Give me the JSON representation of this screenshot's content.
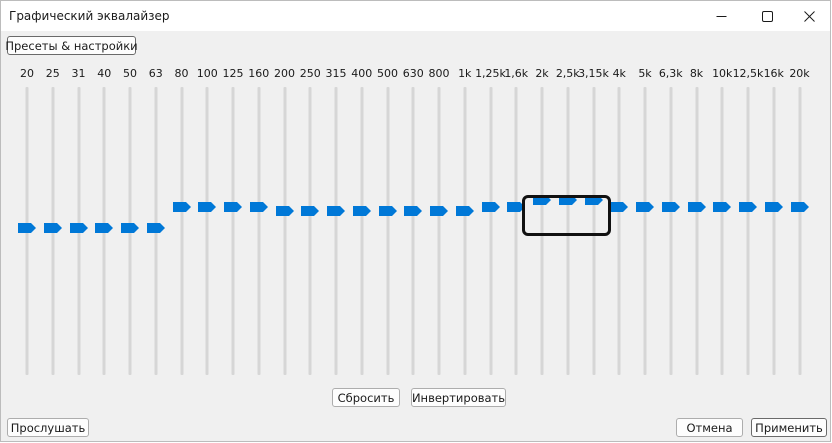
{
  "window": {
    "title": "Графический эквалайзер",
    "controls": [
      "minimize-icon",
      "maximize-icon",
      "close-icon"
    ]
  },
  "toolbar": {
    "presets_label": "Пресеты & настройки"
  },
  "equalizer": {
    "accent_color": "#0078d7",
    "bands": [
      {
        "label": "20",
        "level": 0
      },
      {
        "label": "25",
        "level": 0
      },
      {
        "label": "31",
        "level": 0
      },
      {
        "label": "40",
        "level": 0
      },
      {
        "label": "50",
        "level": 0
      },
      {
        "label": "63",
        "level": 0
      },
      {
        "label": "80",
        "level": 0.143
      },
      {
        "label": "100",
        "level": 0.143
      },
      {
        "label": "125",
        "level": 0.143
      },
      {
        "label": "160",
        "level": 0.143
      },
      {
        "label": "200",
        "level": 0.115
      },
      {
        "label": "250",
        "level": 0.115
      },
      {
        "label": "315",
        "level": 0.115
      },
      {
        "label": "400",
        "level": 0.115
      },
      {
        "label": "500",
        "level": 0.115
      },
      {
        "label": "630",
        "level": 0.115
      },
      {
        "label": "800",
        "level": 0.115
      },
      {
        "label": "1k",
        "level": 0.115
      },
      {
        "label": "1,25k",
        "level": 0.143
      },
      {
        "label": "1,6k",
        "level": 0.143
      },
      {
        "label": "2k",
        "level": 0.195
      },
      {
        "label": "2,5k",
        "level": 0.195
      },
      {
        "label": "3,15k",
        "level": 0.195
      },
      {
        "label": "4k",
        "level": 0.143
      },
      {
        "label": "5k",
        "level": 0.143
      },
      {
        "label": "6,3k",
        "level": 0.143
      },
      {
        "label": "8k",
        "level": 0.143
      },
      {
        "label": "10k",
        "level": 0.143
      },
      {
        "label": "12,5k",
        "level": 0.143
      },
      {
        "label": "16k",
        "level": 0.143
      },
      {
        "label": "20k",
        "level": 0.143
      }
    ]
  },
  "actions": {
    "reset_label": "Сбросить",
    "invert_label": "Инвертировать",
    "listen_label": "Прослушать",
    "cancel_label": "Отмена",
    "apply_label": "Применить"
  }
}
